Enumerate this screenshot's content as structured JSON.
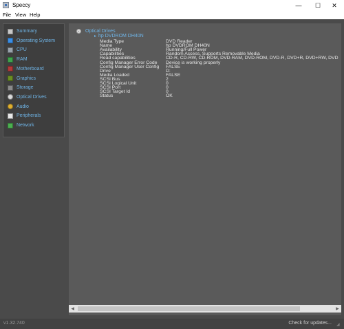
{
  "window": {
    "title": "Speccy",
    "minimize": "—",
    "maximize": "☐",
    "close": "✕"
  },
  "menu": {
    "file": "File",
    "view": "View",
    "help": "Help"
  },
  "sidebar": {
    "items": [
      {
        "label": "Summary",
        "icon": "summary-icon",
        "color": "#c8c8c8"
      },
      {
        "label": "Operating System",
        "icon": "windows-icon",
        "color": "#3a8ee6"
      },
      {
        "label": "CPU",
        "icon": "cpu-icon",
        "color": "#9aa3ad"
      },
      {
        "label": "RAM",
        "icon": "ram-icon",
        "color": "#3fa34d"
      },
      {
        "label": "Motherboard",
        "icon": "motherboard-icon",
        "color": "#b23a3a"
      },
      {
        "label": "Graphics",
        "icon": "graphics-icon",
        "color": "#6b8e23"
      },
      {
        "label": "Storage",
        "icon": "storage-icon",
        "color": "#8a8a8a"
      },
      {
        "label": "Optical Drives",
        "icon": "optical-drive-icon",
        "color": "#d9d9d9"
      },
      {
        "label": "Audio",
        "icon": "audio-icon",
        "color": "#e0b030"
      },
      {
        "label": "Peripherals",
        "icon": "peripherals-icon",
        "color": "#e8e8e8"
      },
      {
        "label": "Network",
        "icon": "network-icon",
        "color": "#4caf50"
      }
    ]
  },
  "main": {
    "section_title": "Optical Drives",
    "device_name": "hp DVDROM DH40N",
    "properties": [
      {
        "key": "Media Type",
        "value": "DVD Reader"
      },
      {
        "key": "Name",
        "value": "hp DVDROM DH40N"
      },
      {
        "key": "Availability",
        "value": "Running/Full Power"
      },
      {
        "key": "Capabilities",
        "value": "Random Access, Supports Removable Media"
      },
      {
        "key": "Read capabilities",
        "value": "CD-R, CD-RW, CD-ROM, DVD-RAM, DVD-ROM, DVD-R, DVD+R, DVD+RW, DVD"
      },
      {
        "key": "Config Manager Error Code",
        "value": "Device is working properly"
      },
      {
        "key": "Config Manager User Config",
        "value": "FALSE"
      },
      {
        "key": "Drive",
        "value": "D:"
      },
      {
        "key": "Media Loaded",
        "value": "FALSE"
      },
      {
        "key": "SCSI Bus",
        "value": "2"
      },
      {
        "key": "SCSI Logical Unit",
        "value": "0"
      },
      {
        "key": "SCSI Port",
        "value": "0"
      },
      {
        "key": "SCSI Target Id",
        "value": "0"
      },
      {
        "key": "Status",
        "value": "OK"
      }
    ]
  },
  "scrollbar": {
    "left_arrow": "◀",
    "right_arrow": "▶"
  },
  "status": {
    "version": "v1.32.740",
    "update_link": "Check for updates..."
  }
}
